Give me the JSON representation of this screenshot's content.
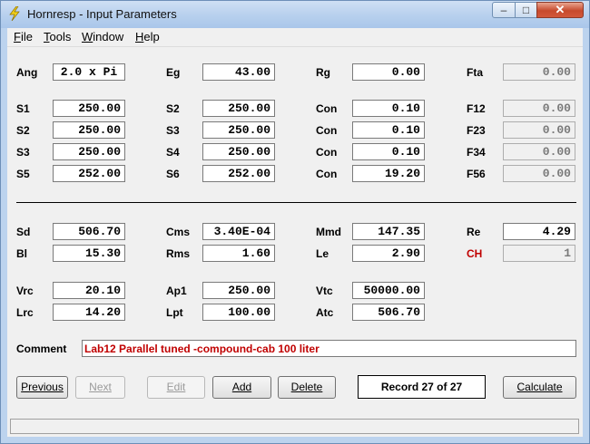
{
  "window": {
    "title": "Hornresp - Input Parameters"
  },
  "title_buttons": {
    "min": "‒",
    "max": "□",
    "close": "✕"
  },
  "menu": [
    {
      "label": "File",
      "key": "F",
      "rest": "ile"
    },
    {
      "label": "Tools",
      "key": "T",
      "rest": "ools"
    },
    {
      "label": "Window",
      "key": "W",
      "rest": "indow"
    },
    {
      "label": "Help",
      "key": "H",
      "rest": "elp"
    }
  ],
  "params": {
    "ang": {
      "label": "Ang",
      "value": "2.0 x Pi"
    },
    "eg": {
      "label": "Eg",
      "value": "43.00"
    },
    "rg": {
      "label": "Rg",
      "value": "0.00"
    },
    "fta": {
      "label": "Fta",
      "value": "0.00"
    },
    "s1": {
      "label": "S1",
      "value": "250.00"
    },
    "s2a": {
      "label": "S2",
      "value": "250.00"
    },
    "s2b": {
      "label": "S2",
      "value": "250.00"
    },
    "s3a": {
      "label": "S3",
      "value": "250.00"
    },
    "s3b": {
      "label": "S3",
      "value": "250.00"
    },
    "s4": {
      "label": "S4",
      "value": "250.00"
    },
    "s5": {
      "label": "S5",
      "value": "252.00"
    },
    "s6": {
      "label": "S6",
      "value": "252.00"
    },
    "con1": {
      "label": "Con",
      "value": "0.10"
    },
    "con2": {
      "label": "Con",
      "value": "0.10"
    },
    "con3": {
      "label": "Con",
      "value": "0.10"
    },
    "con4": {
      "label": "Con",
      "value": "19.20"
    },
    "f12": {
      "label": "F12",
      "value": "0.00"
    },
    "f23": {
      "label": "F23",
      "value": "0.00"
    },
    "f34": {
      "label": "F34",
      "value": "0.00"
    },
    "f56": {
      "label": "F56",
      "value": "0.00"
    },
    "sd": {
      "label": "Sd",
      "value": "506.70"
    },
    "cms": {
      "label": "Cms",
      "value": "3.40E-04"
    },
    "mmd": {
      "label": "Mmd",
      "value": "147.35"
    },
    "re": {
      "label": "Re",
      "value": "4.29"
    },
    "bl": {
      "label": "Bl",
      "value": "15.30"
    },
    "rms": {
      "label": "Rms",
      "value": "1.60"
    },
    "le": {
      "label": "Le",
      "value": "2.90"
    },
    "ch": {
      "label": "CH",
      "value": "1"
    },
    "vrc": {
      "label": "Vrc",
      "value": "20.10"
    },
    "ap1": {
      "label": "Ap1",
      "value": "250.00"
    },
    "vtc": {
      "label": "Vtc",
      "value": "50000.00"
    },
    "lrc": {
      "label": "Lrc",
      "value": "14.20"
    },
    "lpt": {
      "label": "Lpt",
      "value": "100.00"
    },
    "atc": {
      "label": "Atc",
      "value": "506.70"
    }
  },
  "comment": {
    "label": "Comment",
    "value": "Lab12 Parallel tuned -compound-cab 100 liter"
  },
  "buttons": {
    "previous": "Previous",
    "next": "Next",
    "edit": "Edit",
    "add": "Add",
    "delete": "Delete",
    "calculate": "Calculate"
  },
  "record": "Record 27 of 27",
  "colors": {
    "accent_red": "#c00000",
    "title_bar": "#bcd3ee",
    "close_button": "#c74a2d"
  }
}
